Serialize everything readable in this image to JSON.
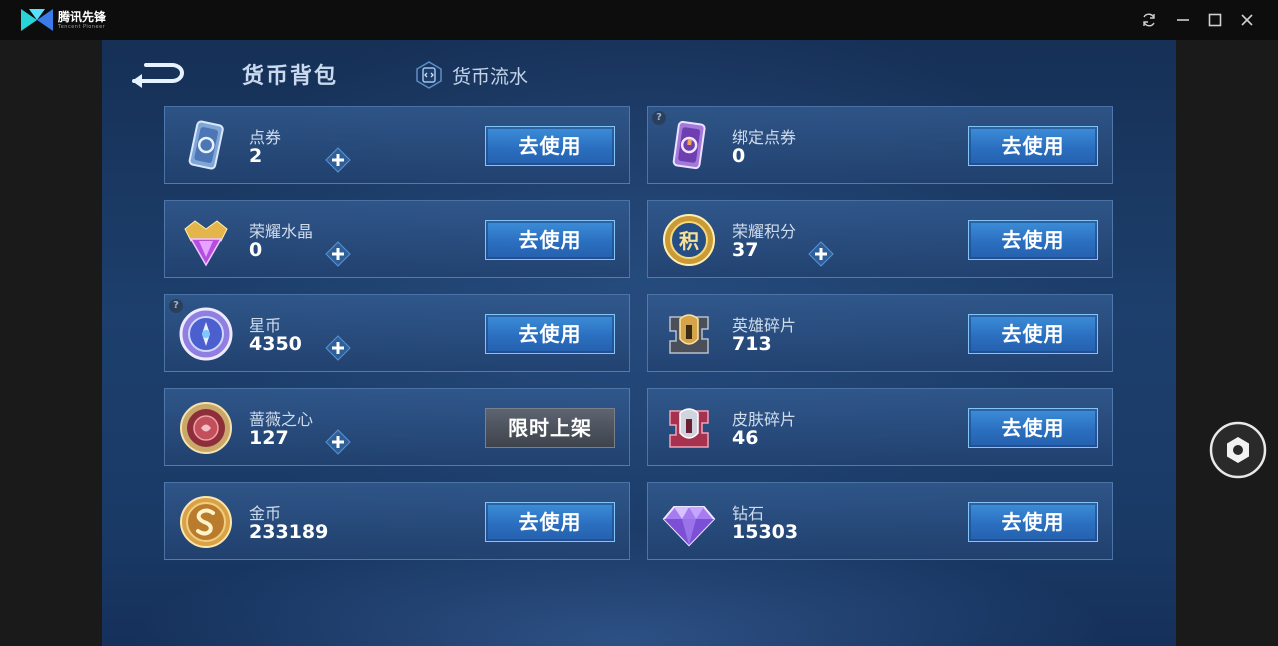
{
  "window": {
    "app_name": "腾讯先锋",
    "app_name_en": "Tencent Pioneer",
    "controls": [
      "refresh-icon",
      "minimize-icon",
      "maximize-icon",
      "close-icon"
    ]
  },
  "header": {
    "title": "货币背包",
    "flow_tab_label": "货币流水"
  },
  "currencies": [
    {
      "name": "点券",
      "value": "2",
      "has_plus": true,
      "has_help": false,
      "action": "去使用",
      "icon": "coupon-card-icon"
    },
    {
      "name": "绑定点券",
      "value": "0",
      "has_plus": false,
      "has_help": true,
      "action": "去使用",
      "icon": "bound-coupon-card-icon"
    },
    {
      "name": "荣耀水晶",
      "value": "0",
      "has_plus": true,
      "has_help": false,
      "action": "去使用",
      "icon": "glory-crystal-icon"
    },
    {
      "name": "荣耀积分",
      "value": "37",
      "has_plus": true,
      "has_help": false,
      "action": "去使用",
      "icon": "glory-points-icon"
    },
    {
      "name": "星币",
      "value": "4350",
      "has_plus": true,
      "has_help": true,
      "action": "去使用",
      "icon": "star-coin-icon"
    },
    {
      "name": "英雄碎片",
      "value": "713",
      "has_plus": false,
      "has_help": false,
      "action": "去使用",
      "icon": "hero-fragment-icon"
    },
    {
      "name": "蔷薇之心",
      "value": "127",
      "has_plus": true,
      "has_help": false,
      "action": "限时上架",
      "icon": "rose-heart-icon"
    },
    {
      "name": "皮肤碎片",
      "value": "46",
      "has_plus": false,
      "has_help": false,
      "action": "去使用",
      "icon": "skin-fragment-icon"
    },
    {
      "name": "金币",
      "value": "233189",
      "has_plus": false,
      "has_help": false,
      "action": "去使用",
      "icon": "gold-coin-icon"
    },
    {
      "name": "钻石",
      "value": "15303",
      "has_plus": false,
      "has_help": false,
      "action": "去使用",
      "icon": "diamond-icon"
    }
  ],
  "glyphs": {
    "help": "?",
    "points_char": "积"
  },
  "colors": {
    "use_button": "#2b6fc0",
    "limited_button": "#4a505a",
    "card_border": "#6e9bd2",
    "page_bg": "#1d3f6c"
  }
}
